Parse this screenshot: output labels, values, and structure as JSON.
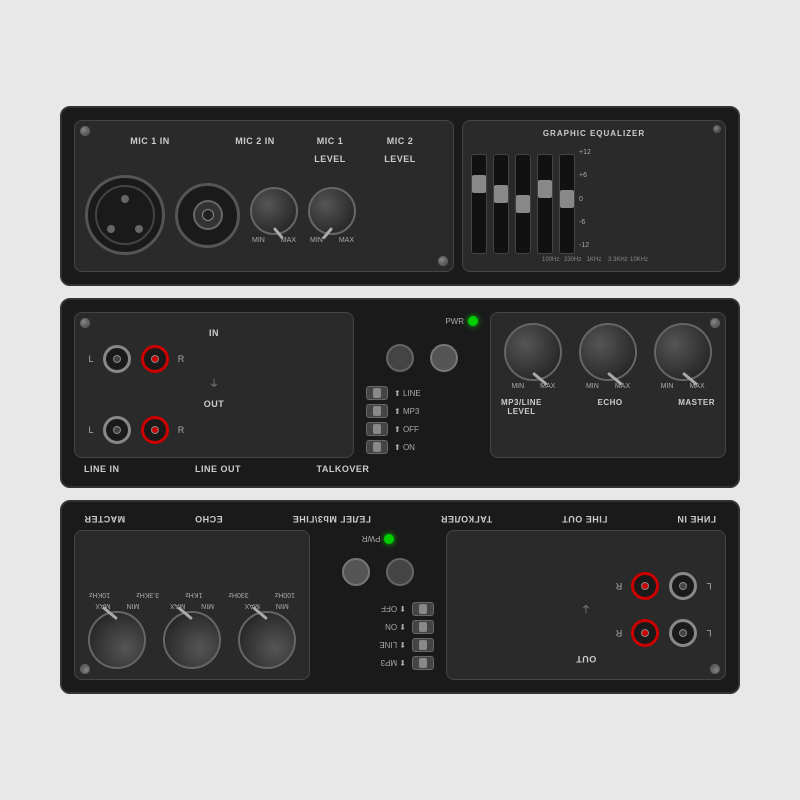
{
  "colors": {
    "bg": "#e8e8e8",
    "panel": "#1a1a1a",
    "section": "#2a2a2a",
    "text": "#cccccc",
    "accent_green": "#00cc00"
  },
  "top_panel": {
    "mic1_in_label": "MIC 1 IN",
    "mic2_in_label": "MIC 2 IN",
    "mic1_level_label": "MIC 1\nLEVEL",
    "mic2_level_label": "MIC 2\nLEVEL",
    "eq_title": "GRAPHIC EQUALIZER",
    "eq_db_labels": [
      "+12",
      "+6",
      "0",
      "-6",
      "-12"
    ],
    "eq_freq_labels": [
      "100Hz",
      "330Hz",
      "1KHz",
      "3.3KHz",
      "10KHz"
    ],
    "knob_min": "MIN",
    "knob_max": "MAX"
  },
  "mid_panel": {
    "in_label": "IN",
    "out_label": "OUT",
    "l_label": "L",
    "r_label": "R",
    "pwr_label": "PWR",
    "line_label": "LINE",
    "mp3_label": "MP3",
    "off_label": "OFF",
    "on_label": "ON",
    "line_in_label": "LINE IN",
    "line_out_label": "LINE OUT",
    "talkover_label": "TALKOVER",
    "mp3_line_level_label": "MP3/LINE\nLEVEL",
    "echo_label": "ECHO",
    "master_label": "MASTER",
    "knob_min": "MIN",
    "knob_max": "MAX"
  },
  "lower_panel": {
    "mirrored": true,
    "line_in_label": "ГИНЕ ІN",
    "line_out_label": "ГІНЕ ОUТ",
    "talkover_label": "ТАГКОЛЕR",
    "level_label": "ГЕЛЕГ\nМb3\\ГІНЕ",
    "echo_label": "ЕСНО",
    "master_label": "МАСТЕR"
  }
}
